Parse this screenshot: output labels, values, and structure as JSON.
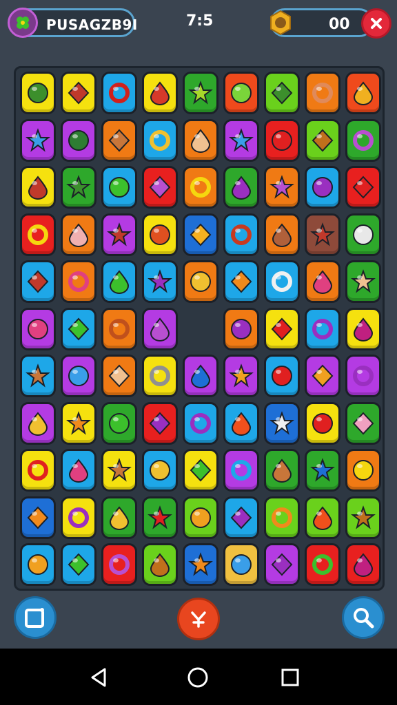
{
  "header": {
    "player_name": "PUSAGZB9I",
    "moves": "7:5",
    "coins": "00",
    "avatar_icon": "clover-icon",
    "coin_icon": "coin-icon",
    "close_icon": "close-icon"
  },
  "board": {
    "columns": 9,
    "rows": 11,
    "empty_cells": [
      [
        5,
        4
      ]
    ],
    "tile_colors": [
      [
        "#f5e10f",
        "#f5e10f",
        "#1ea7e8",
        "#f5e10f",
        "#2ea82b",
        "#ef4a1c",
        "#6ad11c",
        "#f07a14",
        "#ef4a1c"
      ],
      [
        "#b43be3",
        "#b43be3",
        "#f07a14",
        "#1ea7e8",
        "#f07a14",
        "#b43be3",
        "#e8201f",
        "#6ad11c",
        "#2ea82b"
      ],
      [
        "#f5e10f",
        "#2ea82b",
        "#1ea7e8",
        "#e8201f",
        "#f07a14",
        "#2ea82b",
        "#f07a14",
        "#1ea7e8",
        "#e8201f"
      ],
      [
        "#e8201f",
        "#f07a14",
        "#b43be3",
        "#f5e10f",
        "#1e6fd6",
        "#1ea7e8",
        "#f07a14",
        "#8e4a3a",
        "#2ea82b"
      ],
      [
        "#1ea7e8",
        "#f07a14",
        "#1ea7e8",
        "#1ea7e8",
        "#f07a14",
        "#1ea7e8",
        "#1ea7e8",
        "#f07a14",
        "#2ea82b"
      ],
      [
        "#b43be3",
        "#1ea7e8",
        "#f07a14",
        "#b43be3",
        null,
        "#f07a14",
        "#f5e10f",
        "#1ea7e8",
        "#f5e10f"
      ],
      [
        "#1ea7e8",
        "#b43be3",
        "#f07a14",
        "#f5e10f",
        "#b43be3",
        "#b43be3",
        "#1ea7e8",
        "#b43be3",
        "#b43be3"
      ],
      [
        "#b43be3",
        "#f5e10f",
        "#2ea82b",
        "#e8201f",
        "#1ea7e8",
        "#1ea7e8",
        "#1e6fd6",
        "#f5e10f",
        "#2ea82b"
      ],
      [
        "#f5e10f",
        "#1ea7e8",
        "#f5e10f",
        "#1ea7e8",
        "#f5e10f",
        "#b43be3",
        "#2ea82b",
        "#2ea82b",
        "#f07a14"
      ],
      [
        "#1e6fd6",
        "#f5e10f",
        "#2ea82b",
        "#2ea82b",
        "#6ad11c",
        "#1ea7e8",
        "#6ad11c",
        "#6ad11c",
        "#6ad11c"
      ],
      [
        "#1ea7e8",
        "#1ea7e8",
        "#e8201f",
        "#6ad11c",
        "#1e6fd6",
        "#f0c040",
        "#b43be3",
        "#e8201f",
        "#e8201f"
      ]
    ],
    "tile_icon_colors": [
      [
        "#3c8f2c",
        "#c0392b",
        "#d0201c",
        "#d63a2a",
        "#a6d82a",
        "#7ad43a",
        "#3c8f2c",
        "#e08a5a",
        "#f0b020"
      ],
      [
        "#3a9ee8",
        "#2e7d32",
        "#c8763a",
        "#f0c030",
        "#f0c090",
        "#3a9ee8",
        "#e02020",
        "#c0701c",
        "#b84fd0"
      ],
      [
        "#c0392b",
        "#3c8f2c",
        "#3cc02c",
        "#b84fd0",
        "#f5d70f",
        "#9a2fc0",
        "#b84fd0",
        "#9a2fc0",
        "#e02020"
      ],
      [
        "#f5d70f",
        "#f0b0b0",
        "#c0392b",
        "#e05020",
        "#f5b020",
        "#c83a20",
        "#b0603a",
        "#c0392b",
        "#e8e8e8"
      ],
      [
        "#c0392b",
        "#e04080",
        "#3cc02c",
        "#9a2fc0",
        "#f0c030",
        "#f08a1c",
        "#f0f0f0",
        "#e04080",
        "#f0c090"
      ],
      [
        "#e04080",
        "#3cc02c",
        "#c0501c",
        "#b84fd0",
        null,
        "#9a2fc0",
        "#e02020",
        "#9a2fc0",
        "#c02080"
      ],
      [
        "#c8763a",
        "#3a9ee8",
        "#f0c090",
        "#909090",
        "#1e6fd6",
        "#f0a020",
        "#e02020",
        "#f0a020",
        "#9a2fc0"
      ],
      [
        "#f0c030",
        "#f08a1c",
        "#3cc02c",
        "#9a2fc0",
        "#9a2fc0",
        "#f0501c",
        "#f0f0f0",
        "#e02020",
        "#f0a0c0"
      ],
      [
        "#e02020",
        "#e04080",
        "#c8763a",
        "#f0c030",
        "#3cc02c",
        "#1ea7e8",
        "#c8763a",
        "#1e6fd6",
        "#f5d70f"
      ],
      [
        "#f08a1c",
        "#9a2fc0",
        "#f0c030",
        "#e02020",
        "#f0a020",
        "#9a2fc0",
        "#f08a1c",
        "#f0501c",
        "#c0701c"
      ],
      [
        "#f0a020",
        "#3cc02c",
        "#b84fd0",
        "#c0701c",
        "#f08a1c",
        "#3a9ee8",
        "#9a2fc0",
        "#3cc02c",
        "#c02080"
      ]
    ]
  },
  "footer": {
    "left_button_icon": "square-frame-icon",
    "center_button_icon": "shuffle-icon",
    "right_button_icon": "magnifier-icon"
  },
  "system_nav": {
    "back_icon": "back-triangle-icon",
    "home_icon": "home-circle-icon",
    "recents_icon": "recents-square-icon"
  },
  "colors": {
    "background": "#3a4450",
    "board_bg": "#2d3742",
    "accent_blue": "#5aa4cf",
    "close_red": "#e3283a"
  }
}
